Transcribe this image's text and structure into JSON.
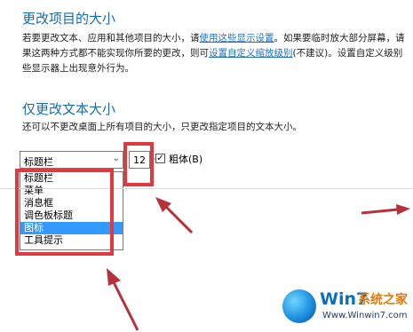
{
  "section_resize": {
    "title": "更改项目的大小",
    "line1_pre": "若要更改文本、应用和其他项目的大小，请",
    "line1_link": "使用这些显示设置",
    "line1_post": "。如果要临时放大部分屏幕，请",
    "line2_pre": "果这两种方式都不能实现你所要的更改，则可",
    "line2_link": "设置自定义缩放级别",
    "line2_post": "(不建议)。设置自定义级别",
    "line3": "些显示器上出现意外行为。"
  },
  "section_text": {
    "title": "仅更改文本大小",
    "description": "还可以不更改桌面上所有项目的大小，只更改指定项目的文本大小。",
    "item_select_value": "标题栏",
    "size_select_value": "12",
    "bold_label": "粗体(B)",
    "bold_checked": true
  },
  "dropdown": {
    "items": [
      "标题栏",
      "菜单",
      "消息框",
      "调色板标题",
      "图标",
      "工具提示"
    ],
    "selected_index": 4
  },
  "watermark": {
    "brand": "Win7",
    "brand_cn": "系统之家",
    "url": "Www.Winwin7.com"
  },
  "colors": {
    "heading": "#1a6aa8",
    "link": "#1f6fbf",
    "highlight": "#e2383e",
    "arrow": "#b7313a",
    "selected": "#3399ff"
  }
}
